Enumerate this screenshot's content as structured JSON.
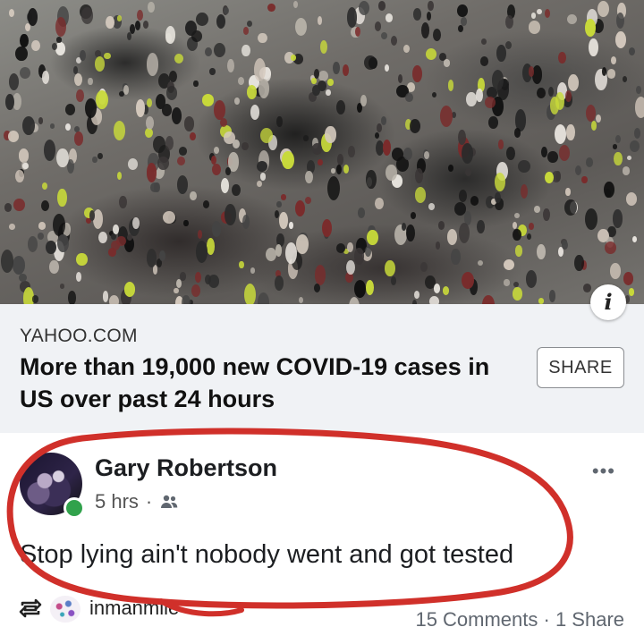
{
  "photo": {
    "description_icon": "info-icon",
    "info_label": "i"
  },
  "link_preview": {
    "source": "YAHOO.COM",
    "title": "More than 19,000 new COVID-19 cases in US over past 24 hours",
    "share_label": "SHARE"
  },
  "comment": {
    "author": "Gary Robertson",
    "time": "5 hrs",
    "separator": "·",
    "audience_icon": "friends-icon",
    "text": "Stop lying ain't nobody went and got tested",
    "more_label": "•••"
  },
  "footer": {
    "repost_icon": "repost-icon",
    "repost_user": "inmanmile",
    "stats": "15 Comments · 1 Share"
  },
  "colors": {
    "online": "#31a24c",
    "annotation": "#d0302a",
    "preview_bg": "#f0f2f5"
  }
}
